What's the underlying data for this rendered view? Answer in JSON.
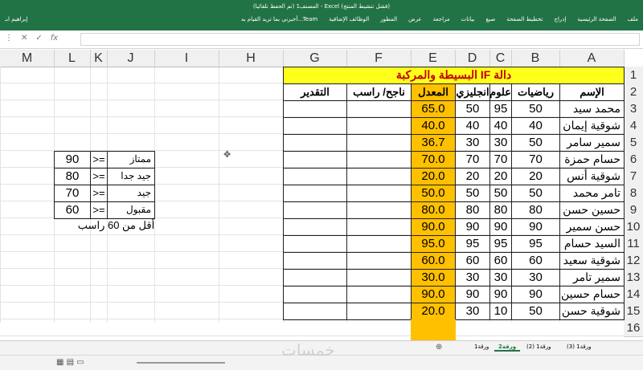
{
  "ribbon": {
    "title": "المصنف1 (تم الحفظ تلقائيا) - Excel (فشل تنشيط المنتج)",
    "user": "إبراهيم ابـ",
    "tell_me": "أخبرني بما تريد القيام به...",
    "tabs": [
      "ملف",
      "الصفحة الرئيسية",
      "إدراج",
      "تخطيط الصفحة",
      "صيغ",
      "بيانات",
      "مراجعة",
      "عرض",
      "المطور",
      "الوظائف الإضافية",
      "Team"
    ]
  },
  "formula_bar": {
    "value": ""
  },
  "columns": [
    "A",
    "B",
    "C",
    "D",
    "E",
    "F",
    "G",
    "H",
    "I",
    "J",
    "K",
    "L",
    "M"
  ],
  "rows": [
    "1",
    "2",
    "3",
    "4",
    "5",
    "6",
    "7",
    "8",
    "9",
    "10",
    "11",
    "12",
    "13",
    "14",
    "15",
    "16"
  ],
  "table": {
    "title": "دالة IF البسيطة والمركبة",
    "headers": {
      "name": "الإسم",
      "math": "رياضيات",
      "science": "علوم",
      "english": "انجليزي",
      "average": "المعدل",
      "pass_fail": "ناجح/ راسب",
      "grade": "التقدير"
    },
    "students": [
      {
        "name": "محمد سيد",
        "math": "50",
        "science": "95",
        "english": "50",
        "average": "65.0"
      },
      {
        "name": "شوقية إيمان",
        "math": "40",
        "science": "40",
        "english": "40",
        "average": "40.0"
      },
      {
        "name": "سمير سامر",
        "math": "50",
        "science": "30",
        "english": "30",
        "average": "36.7"
      },
      {
        "name": "حسام حمزة",
        "math": "70",
        "science": "70",
        "english": "70",
        "average": "70.0"
      },
      {
        "name": "شوقية أنس",
        "math": "20",
        "science": "20",
        "english": "20",
        "average": "20.0"
      },
      {
        "name": "تامر محمد",
        "math": "50",
        "science": "50",
        "english": "50",
        "average": "50.0"
      },
      {
        "name": "حسين حسن",
        "math": "80",
        "science": "80",
        "english": "80",
        "average": "80.0"
      },
      {
        "name": "حسن سمير",
        "math": "90",
        "science": "90",
        "english": "90",
        "average": "90.0"
      },
      {
        "name": "السيد حسام",
        "math": "95",
        "science": "95",
        "english": "95",
        "average": "95.0"
      },
      {
        "name": "شوقية سعيد",
        "math": "60",
        "science": "60",
        "english": "60",
        "average": "60.0"
      },
      {
        "name": "سمير تامر",
        "math": "30",
        "science": "30",
        "english": "30",
        "average": "30.0"
      },
      {
        "name": "حسام حسين",
        "math": "90",
        "science": "90",
        "english": "90",
        "average": "90.0"
      },
      {
        "name": "شوقية حسن",
        "math": "50",
        "science": "10",
        "english": "30",
        "average": "20.0"
      }
    ]
  },
  "grade_scale": [
    {
      "label": "ممتاز",
      "op": ">=",
      "value": "90"
    },
    {
      "label": "جيد جدا",
      "op": ">=",
      "value": "80"
    },
    {
      "label": "جيد",
      "op": ">=",
      "value": "70"
    },
    {
      "label": "مقبول",
      "op": ">=",
      "value": "60"
    }
  ],
  "fail_note": "أقل من 60 راسب",
  "sheet_tabs": [
    "ورقة1",
    "ورقة2",
    "ورقة1 (2)",
    "ورقة1 (3)"
  ],
  "active_sheet": "ورقة2",
  "watermark": "خمسات",
  "colors": {
    "title_fill": "#ffff1c",
    "average_fill": "#ffc000",
    "title_text": "#c00000",
    "ribbon": "#217346"
  }
}
